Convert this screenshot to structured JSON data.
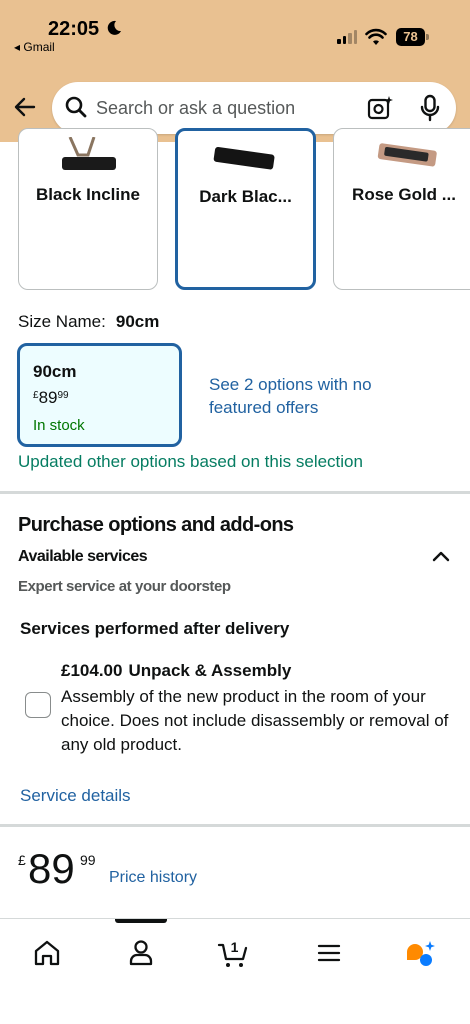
{
  "status_bar": {
    "time": "22:05",
    "back_app": "◂ Gmail",
    "battery": "78"
  },
  "search": {
    "placeholder": "Search or ask a question"
  },
  "styles": [
    {
      "label": "Black Incline",
      "selected": false
    },
    {
      "label": "Dark Blac...",
      "selected": true
    },
    {
      "label": "Rose Gold ...",
      "selected": false
    }
  ],
  "size": {
    "label": "Size Name:",
    "value": "90cm",
    "option": {
      "name": "90cm",
      "currency": "£",
      "price_whole": "89",
      "price_fraction": "99",
      "stock": "In stock"
    },
    "other_options_link": "See 2 options with no featured offers",
    "updated_message": "Updated other options based on this selection"
  },
  "purchase_options": {
    "title": "Purchase options and add-ons",
    "available_services": "Available services",
    "expert_service": "Expert service at your doorstep",
    "after_delivery": "Services performed after delivery",
    "service": {
      "price": "£104.00",
      "name": "Unpack & Assembly",
      "description": "Assembly of the new product in the room of your choice. Does not include disassembly or removal of any old product.",
      "checked": false
    },
    "service_details_link": "Service details"
  },
  "price": {
    "currency": "£",
    "whole": "89",
    "fraction": "99",
    "history_link": "Price history"
  },
  "bottom_nav": {
    "items": [
      "home-icon",
      "account-icon",
      "cart-icon",
      "menu-icon",
      "rufus-icon"
    ],
    "cart_count": "1",
    "active": "account-icon"
  },
  "colors": {
    "header_bg": "#e9c191",
    "link": "#2162a1",
    "stock_green": "#007600",
    "selected_border": "#2162a1"
  }
}
